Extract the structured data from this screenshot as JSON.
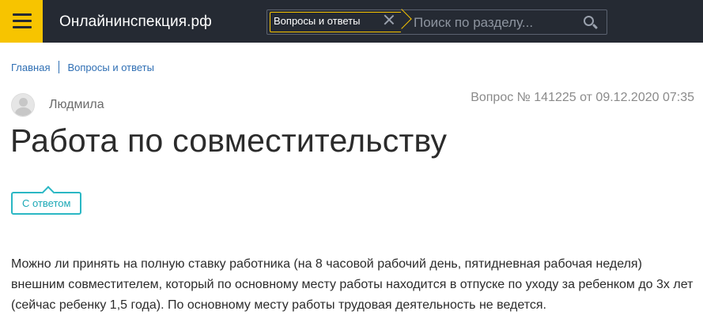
{
  "header": {
    "site_name": "Онлайнинспекция.рф",
    "section_chip": "Вопросы и ответы",
    "search_placeholder": "Поиск по разделу..."
  },
  "breadcrumb": {
    "items": [
      "Главная",
      "Вопросы и ответы"
    ]
  },
  "question": {
    "author": "Людмила",
    "meta": "Вопрос № 141225 от 09.12.2020 07:35",
    "title": "Работа по совместительству",
    "status": "С ответом",
    "text": "Можно ли принять на полную ставку работника (на 8 часовой рабочий день, пятидневная рабочая неделя) внешним совместителем, который по основному месту работы находится в отпуске по уходу за ребенком до 3х лет (сейчас ребенку 1,5 года). По основному месту работы трудовая деятельность не ведется."
  },
  "colors": {
    "header_bg": "#252a33",
    "accent": "#f7c400",
    "link": "#2f6fb4",
    "badge": "#2ab7c4"
  },
  "icons": [
    "menu-icon",
    "close-icon",
    "search-icon",
    "user-avatar-icon"
  ]
}
